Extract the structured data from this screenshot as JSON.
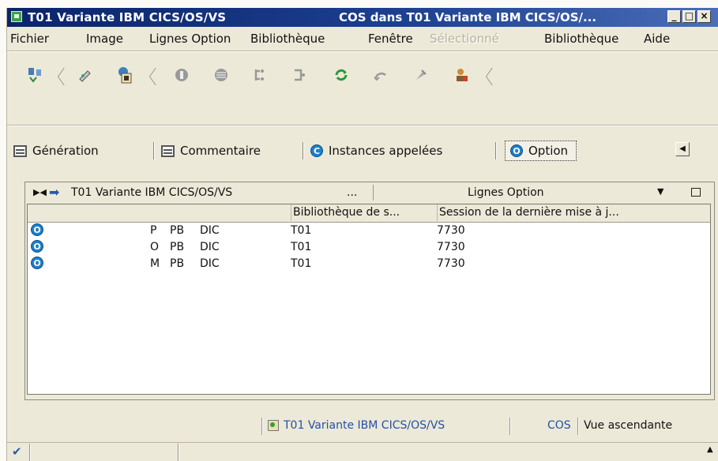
{
  "window": {
    "title": "T01 Variante IBM CICS/OS/VS",
    "title_right": "COS dans T01 Variante IBM CICS/OS/...",
    "controls": {
      "minimize": "_",
      "maximize": "□",
      "close": "×"
    }
  },
  "menu": [
    {
      "label": "Fichier",
      "enabled": true
    },
    {
      "label": "Image",
      "enabled": true
    },
    {
      "label": "Lignes Option",
      "enabled": true
    },
    {
      "label": "Bibliothèque",
      "enabled": true
    },
    {
      "label": "Fenêtre",
      "enabled": true
    },
    {
      "label": "Sélectionné",
      "enabled": false
    },
    {
      "label": "Bibliothèque",
      "enabled": true
    },
    {
      "label": "Aide",
      "enabled": true
    }
  ],
  "toolbar_icons": [
    "open-icon",
    "edit-icon",
    "properties-icon",
    "circle-stop-icon",
    "gear-icon",
    "expand-icon",
    "collapse-icon",
    "refresh-icon",
    "undo-icon",
    "pin-icon",
    "user-icon"
  ],
  "tabs": [
    {
      "label": "Génération",
      "icon": "list-icon"
    },
    {
      "label": "Commentaire",
      "icon": "list-icon"
    },
    {
      "label": "Instances appelées",
      "icon": "c-circle-icon",
      "badge": "C"
    },
    {
      "label": "Option",
      "icon": "o-circle-icon",
      "badge": "O",
      "selected": true
    }
  ],
  "panel": {
    "title": "T01 Variante IBM CICS/OS/VS",
    "title_more": "...",
    "view": "Lignes Option",
    "columns": [
      "",
      "Bibliothèque de s...",
      "Session de la dernière mise à j..."
    ],
    "rows": [
      {
        "badge": "O",
        "c1": "P",
        "c2": "PB",
        "c3": "DIC",
        "library": "T01",
        "session": "7730"
      },
      {
        "badge": "O",
        "c1": "O",
        "c2": "PB",
        "c3": "DIC",
        "library": "T01",
        "session": "7730"
      },
      {
        "badge": "O",
        "c1": "M",
        "c2": "PB",
        "c3": "DIC",
        "library": "T01",
        "session": "7730"
      }
    ]
  },
  "status": {
    "context": "T01 Variante IBM CICS/OS/VS",
    "code": "COS",
    "view": "Vue ascendante"
  },
  "colors": {
    "title_bar": "#0a246a",
    "badge_blue": "#1e7fc8",
    "status_text": "#2250a8",
    "chrome": "#ece9d8"
  }
}
